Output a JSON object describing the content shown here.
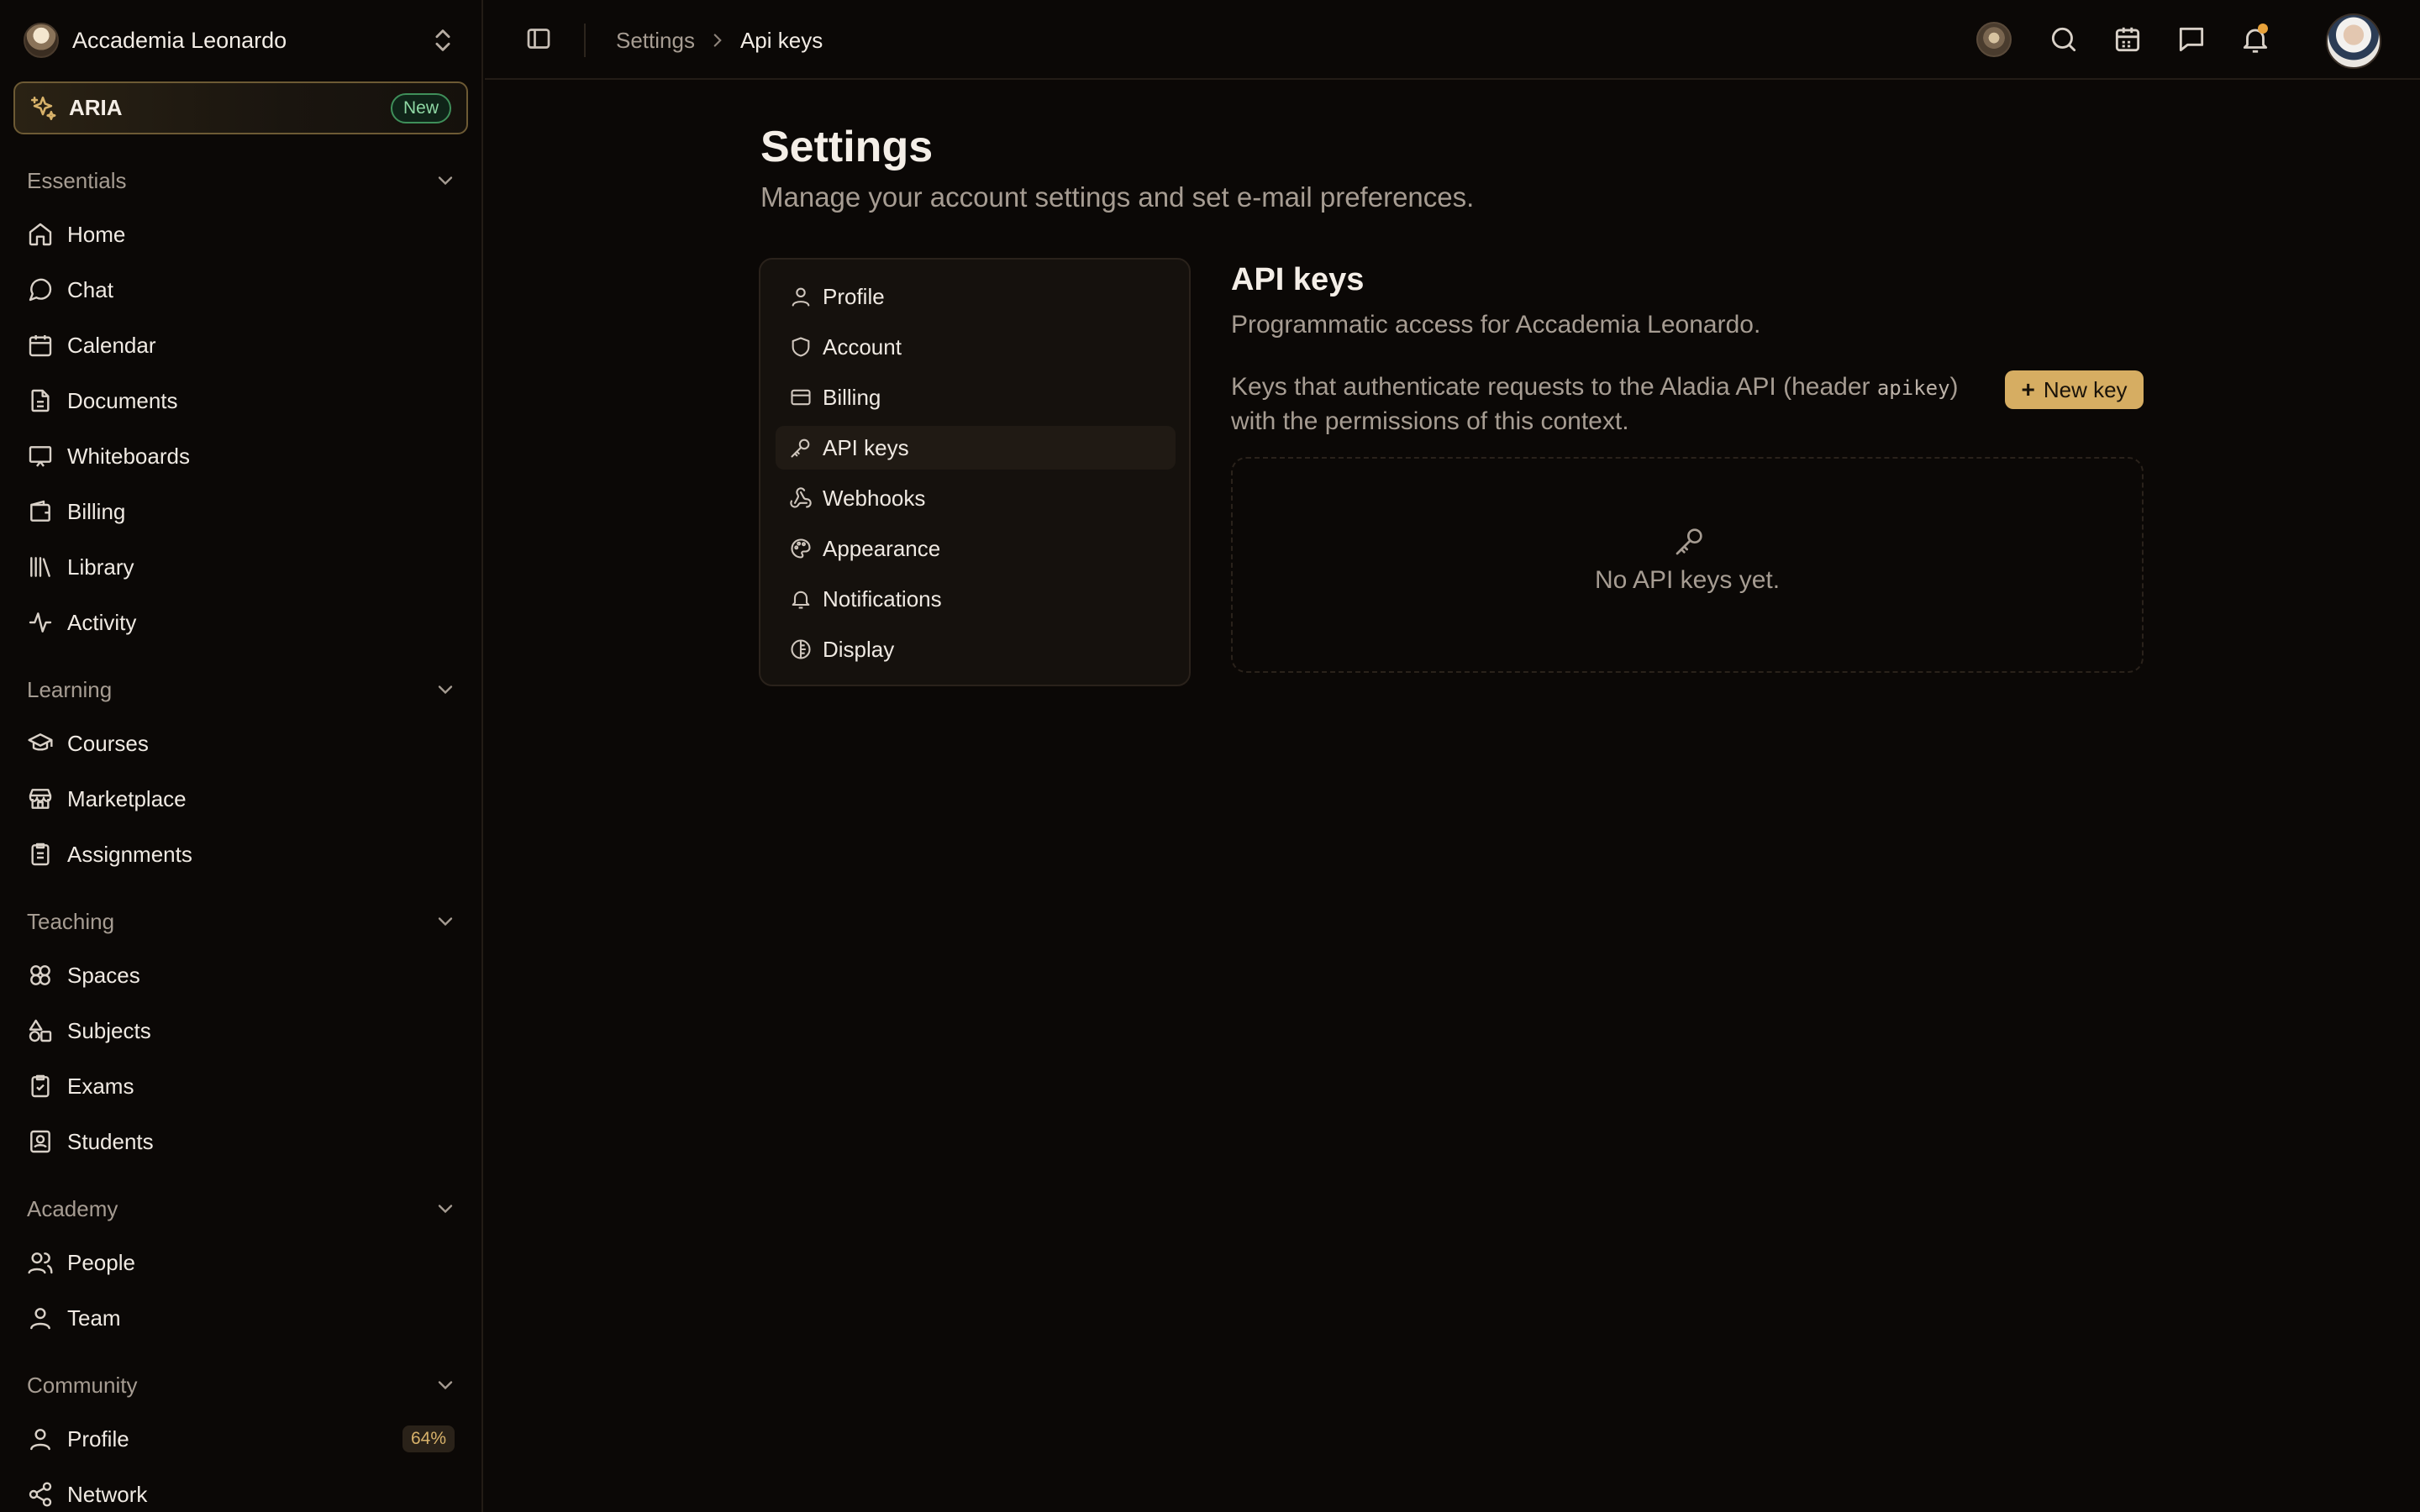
{
  "sidebar": {
    "org_name": "Accademia Leonardo",
    "aria": {
      "label": "ARIA",
      "badge": "New"
    },
    "sections": [
      {
        "title": "Essentials",
        "items": [
          {
            "label": "Home",
            "icon": "home-icon"
          },
          {
            "label": "Chat",
            "icon": "chat-icon"
          },
          {
            "label": "Calendar",
            "icon": "calendar-icon"
          },
          {
            "label": "Documents",
            "icon": "document-icon"
          },
          {
            "label": "Whiteboards",
            "icon": "whiteboard-icon"
          },
          {
            "label": "Billing",
            "icon": "wallet-icon"
          },
          {
            "label": "Library",
            "icon": "library-icon"
          },
          {
            "label": "Activity",
            "icon": "activity-icon"
          }
        ]
      },
      {
        "title": "Learning",
        "items": [
          {
            "label": "Courses",
            "icon": "graduation-cap-icon"
          },
          {
            "label": "Marketplace",
            "icon": "store-icon"
          },
          {
            "label": "Assignments",
            "icon": "clipboard-icon"
          }
        ]
      },
      {
        "title": "Teaching",
        "items": [
          {
            "label": "Spaces",
            "icon": "spaces-icon"
          },
          {
            "label": "Subjects",
            "icon": "shapes-icon"
          },
          {
            "label": "Exams",
            "icon": "clipboard-check-icon"
          },
          {
            "label": "Students",
            "icon": "contact-icon"
          }
        ]
      },
      {
        "title": "Academy",
        "items": [
          {
            "label": "People",
            "icon": "users-icon"
          },
          {
            "label": "Team",
            "icon": "user-icon"
          }
        ]
      },
      {
        "title": "Community",
        "items": [
          {
            "label": "Profile",
            "icon": "user-icon",
            "badge": "64%"
          },
          {
            "label": "Network",
            "icon": "share-icon"
          }
        ]
      }
    ]
  },
  "topbar": {
    "breadcrumb": [
      "Settings",
      "Api keys"
    ],
    "icons": [
      "avatar",
      "search-icon",
      "calendar-icon",
      "chat-icon",
      "bell-icon",
      "user-avatar"
    ]
  },
  "page": {
    "title": "Settings",
    "subtitle": "Manage your account settings and set e-mail preferences."
  },
  "settings_nav": {
    "active": "API keys",
    "items": [
      {
        "label": "Profile",
        "icon": "user-icon"
      },
      {
        "label": "Account",
        "icon": "shield-icon"
      },
      {
        "label": "Billing",
        "icon": "credit-card-icon"
      },
      {
        "label": "API keys",
        "icon": "key-icon"
      },
      {
        "label": "Webhooks",
        "icon": "webhook-icon"
      },
      {
        "label": "Appearance",
        "icon": "palette-icon"
      },
      {
        "label": "Notifications",
        "icon": "bell-icon"
      },
      {
        "label": "Display",
        "icon": "display-icon"
      }
    ]
  },
  "api_keys": {
    "title": "API keys",
    "description": "Programmatic access for Accademia Leonardo.",
    "info_before": "Keys that authenticate requests to the Aladia API (header ",
    "info_code": "apikey",
    "info_after": ") with the permissions of this context.",
    "new_key_label": "New key",
    "empty_text": "No API keys yet."
  },
  "colors": {
    "background": "#0b0806",
    "accent": "#d6ad62",
    "muted_text": "#a69c92",
    "success_badge": "#3f8f5a"
  }
}
